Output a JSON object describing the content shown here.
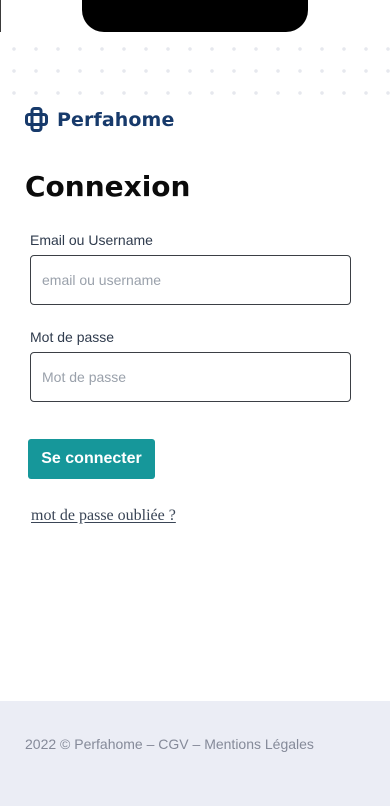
{
  "brand": {
    "name": "Perfahome",
    "color": "#173a6b"
  },
  "page": {
    "title": "Connexion"
  },
  "form": {
    "email_label": "Email ou Username",
    "email_placeholder": "email ou username",
    "email_value": "",
    "password_label": "Mot de passe",
    "password_placeholder": "Mot de passe",
    "password_value": "",
    "submit_label": "Se connecter",
    "submit_color": "#16979a",
    "forgot_label": "mot de passe oubliée ?"
  },
  "footer": {
    "text": "2022 © Perfahome – CGV – Mentions Légales",
    "background": "#ebedf5"
  }
}
